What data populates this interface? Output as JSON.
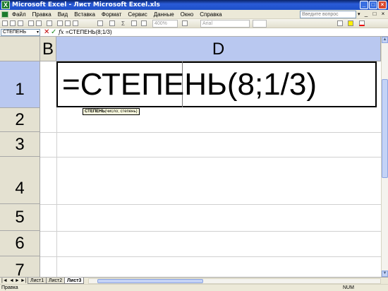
{
  "window": {
    "title": "Microsoft Excel - Лист Microsoft Excel.xls",
    "app_icon": "X",
    "buttons": [
      "_",
      "□",
      "×"
    ]
  },
  "menu": {
    "items": [
      "Файл",
      "Правка",
      "Вид",
      "Вставка",
      "Формат",
      "Сервис",
      "Данные",
      "Окно",
      "Справка"
    ],
    "help_placeholder": "Введите вопрос",
    "doc_buttons": [
      "_",
      "□",
      "×"
    ]
  },
  "toolbar": {
    "zoom": "400%",
    "font": "Arial",
    "sum_icon": "Σ"
  },
  "formula_bar": {
    "name_box": "СТЕПЕНЬ",
    "cancel": "✕",
    "enter": "✓",
    "fx": "fx",
    "formula": "=СТЕПЕНЬ(8;1/3)"
  },
  "grid": {
    "columns": [
      "B",
      "D"
    ],
    "rows": [
      "1",
      "2",
      "3",
      "4",
      "5",
      "6",
      "7"
    ],
    "active_cell_text": "=СТЕПЕНЬ(8;1/3)",
    "tooltip_func": "СТЕПЕНЬ",
    "tooltip_args": "(число; степень)"
  },
  "sheets": {
    "tabs": [
      "Лист1",
      "Лист2",
      "Лист3"
    ],
    "active": "Лист3",
    "nav": [
      "|◄",
      "◄",
      "►",
      "►|"
    ]
  },
  "status": {
    "mode": "Правка",
    "num": "NUM"
  },
  "colors": {
    "title_bar": "#1d4fc8",
    "header_selected": "#b9c8f0",
    "header": "#e4e1d1",
    "chrome": "#ece9d8"
  }
}
